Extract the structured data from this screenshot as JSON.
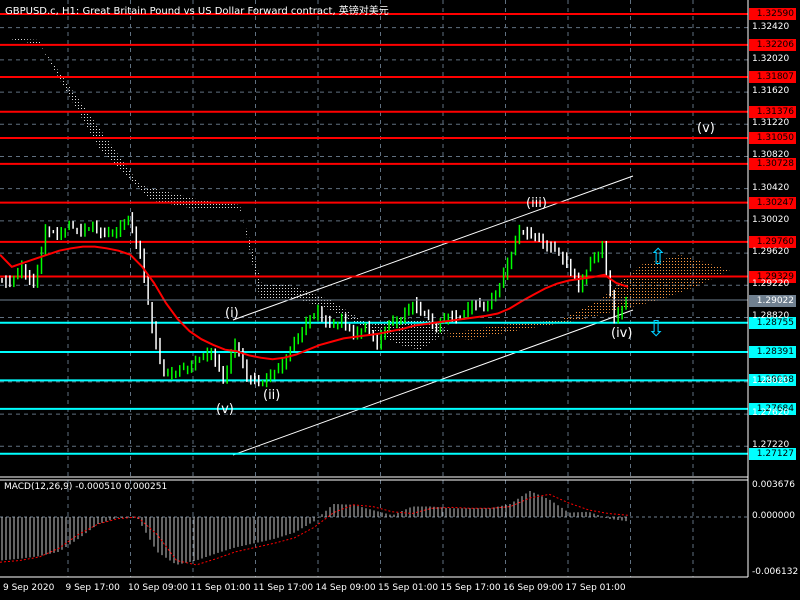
{
  "title": "GBPUSD.c, H1:  Great Britain Pound vs US Dollar Forward contract, 英镑对美元",
  "macd_label": "MACD(12,26,9) -0.000510 0.000251",
  "colors": {
    "resistance": "#ff0000",
    "support": "#00ffff",
    "current": "#708090",
    "bars": "#00ff00",
    "ma": "#ff0000",
    "macd_signal": "#ff0000"
  },
  "price_levels": [
    {
      "value": "1.32590",
      "type": "resistance"
    },
    {
      "value": "1.32206",
      "type": "resistance"
    },
    {
      "value": "1.31807",
      "type": "resistance"
    },
    {
      "value": "1.31376",
      "type": "resistance"
    },
    {
      "value": "1.31050",
      "type": "resistance"
    },
    {
      "value": "1.30728",
      "type": "resistance"
    },
    {
      "value": "1.30247",
      "type": "resistance"
    },
    {
      "value": "1.29760",
      "type": "resistance"
    },
    {
      "value": "1.29329",
      "type": "resistance"
    },
    {
      "value": "1.29022",
      "type": "current"
    },
    {
      "value": "1.28755",
      "type": "support"
    },
    {
      "value": "1.28391",
      "type": "support"
    },
    {
      "value": "1.28038",
      "type": "support"
    },
    {
      "value": "1.27684",
      "type": "support"
    },
    {
      "value": "1.27127",
      "type": "support"
    }
  ],
  "price_ticks": [
    "1.32420",
    "1.32020",
    "1.31620",
    "1.31220",
    "1.30820",
    "1.30420",
    "1.30020",
    "1.29620",
    "1.29220",
    "1.28820",
    "1.28020",
    "1.27620",
    "1.27220"
  ],
  "macd_ticks": [
    "0.003676",
    "0.000000",
    "-0.006132"
  ],
  "time_labels": [
    "9 Sep 2020",
    "9 Sep 17:00",
    "10 Sep 09:00",
    "11 Sep 01:00",
    "11 Sep 17:00",
    "14 Sep 09:00",
    "15 Sep 01:00",
    "15 Sep 17:00",
    "16 Sep 09:00",
    "17 Sep 01:00"
  ],
  "wave_labels": [
    "(v)",
    "(i)",
    "(ii)",
    "(iii)",
    "(iv)",
    "(v)"
  ],
  "chart_data": {
    "type": "line",
    "symbol": "GBPUSD.c",
    "timeframe": "H1",
    "close": [
      1.293,
      1.2925,
      1.2945,
      1.292,
      1.299,
      1.2985,
      1.2995,
      1.299,
      1.2995,
      1.2985,
      1.299,
      1.3005,
      1.296,
      1.287,
      1.281,
      1.2815,
      1.282,
      1.283,
      1.284,
      1.2805,
      1.285,
      1.281,
      1.28,
      1.281,
      1.2825,
      1.285,
      1.2875,
      1.289,
      1.287,
      1.288,
      1.286,
      1.287,
      1.285,
      1.2875,
      1.288,
      1.29,
      1.2885,
      1.287,
      1.2885,
      1.288,
      1.29,
      1.2895,
      1.291,
      1.295,
      1.299,
      1.2985,
      1.2975,
      1.2965,
      1.295,
      1.292,
      1.295,
      1.297,
      1.288,
      1.2902
    ],
    "ma": [
      1.296,
      1.2945,
      1.295,
      1.2955,
      1.296,
      1.2965,
      1.2968,
      1.297,
      1.297,
      1.2968,
      1.2965,
      1.296,
      1.2945,
      1.2925,
      1.29,
      1.288,
      1.2865,
      1.2855,
      1.2848,
      1.2842,
      1.284,
      1.2835,
      1.2832,
      1.283,
      1.2832,
      1.2836,
      1.2842,
      1.2848,
      1.2852,
      1.2856,
      1.2858,
      1.286,
      1.2862,
      1.2865,
      1.2868,
      1.2872,
      1.2874,
      1.2876,
      1.2878,
      1.288,
      1.2882,
      1.2884,
      1.2887,
      1.2893,
      1.2902,
      1.291,
      1.2918,
      1.2924,
      1.2928,
      1.293,
      1.2932,
      1.2935,
      1.2925,
      1.292
    ],
    "macd": [
      -0.005,
      -0.0048,
      -0.0045,
      -0.004,
      -0.0025,
      -0.0008,
      -0.0001,
      -0.0001,
      -0.004,
      -0.0055,
      -0.005,
      -0.0042,
      -0.0035,
      -0.003,
      -0.0025,
      -0.0018,
      -0.0005,
      0.0015,
      0.0014,
      0.0008,
      0.0002,
      0.0012,
      0.0012,
      0.001,
      0.001,
      0.001,
      0.0015,
      0.003,
      0.002,
      0.0005,
      0.0006,
      -0.0002,
      -0.0005
    ],
    "signal": [
      -0.0052,
      -0.005,
      -0.0046,
      -0.0036,
      -0.002,
      -0.0008,
      -0.0002,
      0.0,
      -0.002,
      -0.005,
      -0.0055,
      -0.0048,
      -0.004,
      -0.0035,
      -0.003,
      -0.0024,
      -0.0012,
      0.0005,
      0.0014,
      0.0012,
      0.0006,
      0.0004,
      0.001,
      0.0011,
      0.001,
      0.001,
      0.0012,
      0.0022,
      0.0026,
      0.0016,
      0.0008,
      0.0004,
      0.0002
    ],
    "ylim": [
      1.266,
      1.3275
    ],
    "macd_ylim": [
      -0.006132,
      0.003676
    ]
  }
}
